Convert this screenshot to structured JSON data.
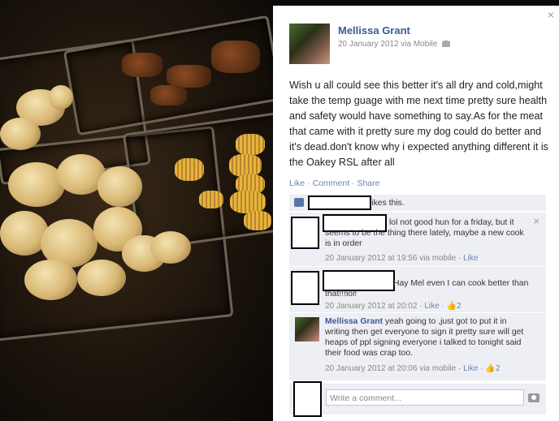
{
  "post": {
    "author": "Mellissa Grant",
    "meta": "20 January 2012 via Mobile",
    "status": "Wish u all could see this better it's all dry and cold,might take the temp guage with me next time pretty sure health and safety would have something to say.As for the meat that came with it pretty sure my dog could do better and it's dead.don't know why i expected anything different it is the Oakey RSL after all",
    "actions": {
      "like": "Like",
      "comment": "Comment",
      "share": "Share",
      "separator": "·"
    },
    "close": "×"
  },
  "likes": {
    "text": "likes this."
  },
  "comments": [
    {
      "text": "lol not good hun for a friday, but it seems to be the thing there lately, maybe a new cook is in order",
      "time": "20 January 2012 at 19:56 via mobile",
      "like": "Like",
      "remove": "×"
    },
    {
      "text": "Hay Mel even I can cook better than that!!!lol!",
      "time": "20 January 2012 at 20:02",
      "like": "Like",
      "like_count": "2"
    },
    {
      "author": "Mellissa Grant",
      "text": "yeah going to ,just got to put it in writing then get everyone to sign it pretty sure will get heaps of ppl signing everyone i talked to tonight said their food was crap too.",
      "time": "20 January 2012 at 20:06 via mobile",
      "like": "Like",
      "like_count": "2"
    }
  ],
  "composer": {
    "placeholder": "Write a comment..."
  },
  "colors": {
    "link": "#3b5998",
    "comment_bg": "#edeff4",
    "action": "#6d84b4"
  }
}
